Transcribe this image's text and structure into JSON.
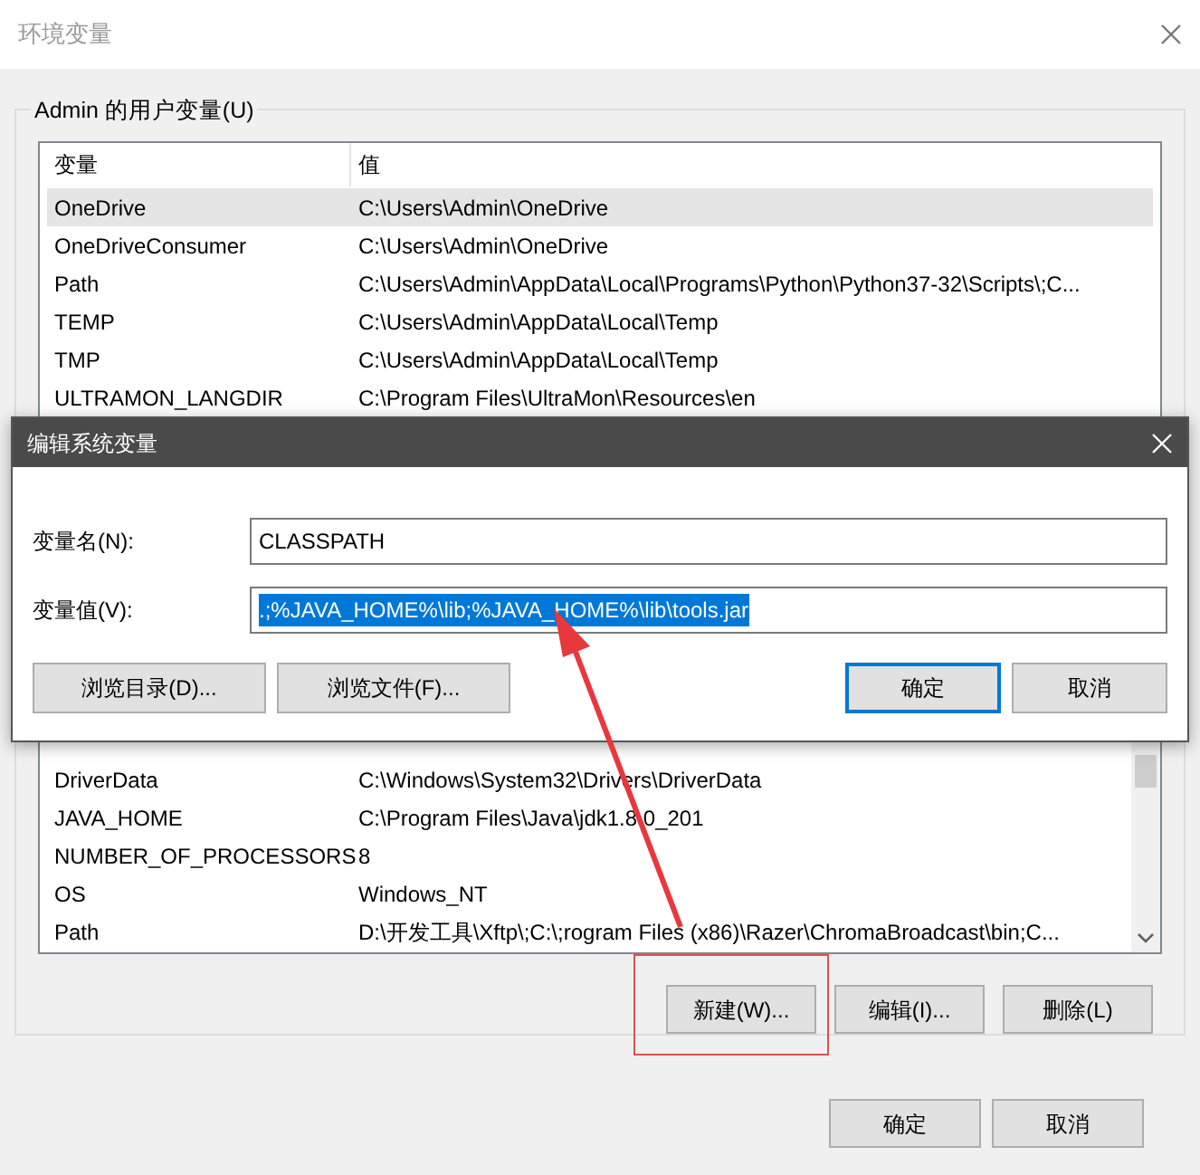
{
  "window": {
    "title": "环境变量"
  },
  "user_variables": {
    "title": "Admin 的用户变量(U)",
    "columns": [
      "变量",
      "值"
    ],
    "rows": [
      {
        "name": "OneDrive",
        "value": "C:\\Users\\Admin\\OneDrive",
        "selected": true
      },
      {
        "name": "OneDriveConsumer",
        "value": "C:\\Users\\Admin\\OneDrive",
        "selected": false
      },
      {
        "name": "Path",
        "value": "C:\\Users\\Admin\\AppData\\Local\\Programs\\Python\\Python37-32\\Scripts\\;C...",
        "selected": false
      },
      {
        "name": "TEMP",
        "value": "C:\\Users\\Admin\\AppData\\Local\\Temp",
        "selected": false
      },
      {
        "name": "TMP",
        "value": "C:\\Users\\Admin\\AppData\\Local\\Temp",
        "selected": false
      },
      {
        "name": "ULTRAMON_LANGDIR",
        "value": "C:\\Program Files\\UltraMon\\Resources\\en",
        "selected": false
      }
    ]
  },
  "system_variables": {
    "rows": [
      {
        "name": "DriverData",
        "value": "C:\\Windows\\System32\\Drivers\\DriverData",
        "selected": false
      },
      {
        "name": "JAVA_HOME",
        "value": "C:\\Program Files\\Java\\jdk1.8.0_201",
        "selected": false
      },
      {
        "name": "NUMBER_OF_PROCESSORS",
        "value": "8",
        "selected": false
      },
      {
        "name": "OS",
        "value": "Windows_NT",
        "selected": false
      },
      {
        "name": "Path",
        "value": "D:\\开发工具\\Xftp\\;C:\\;rogram Files (x86)\\Razer\\ChromaBroadcast\\bin;C...",
        "selected": false
      }
    ],
    "buttons": [
      {
        "label": "新建(W)...",
        "highlighted": true
      },
      {
        "label": "编辑(I)...",
        "highlighted": false
      },
      {
        "label": "删除(L)",
        "highlighted": false
      }
    ]
  },
  "buttons": [
    "确定",
    "取消"
  ],
  "edit_dialog": {
    "title": "编辑系统变量",
    "fields": [
      {
        "label": "变量名(N):",
        "value": "CLASSPATH",
        "selected": false
      },
      {
        "label": "变量值(V):",
        "value": ".;%JAVA_HOME%\\lib;%JAVA_HOME%\\lib\\tools.jar",
        "selected": true
      }
    ],
    "buttons": [
      {
        "label": "浏览目录(D)...",
        "default": false
      },
      {
        "label": "浏览文件(F)...",
        "default": false
      },
      {
        "label": "确定",
        "default": true
      },
      {
        "label": "取消",
        "default": false
      }
    ]
  }
}
